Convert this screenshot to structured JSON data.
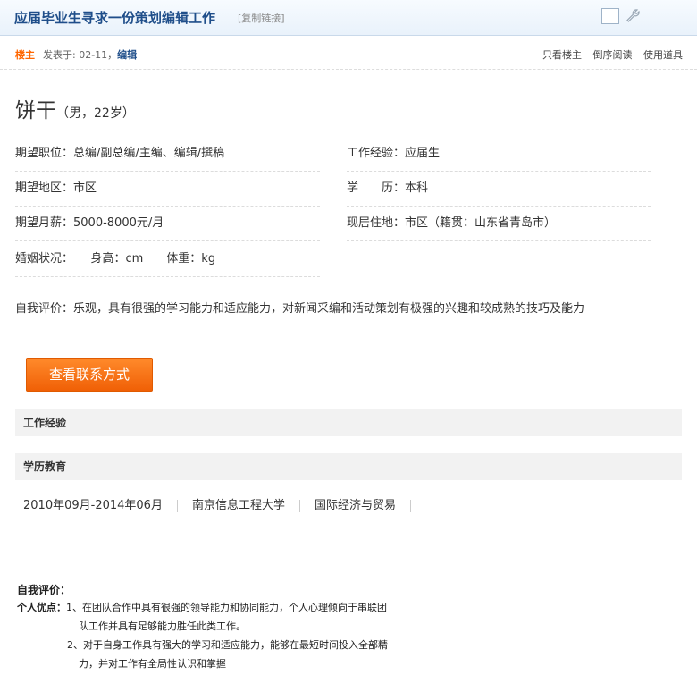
{
  "header": {
    "title": "应届毕业生寻求一份策划编辑工作",
    "copy_link": "[复制链接]"
  },
  "post": {
    "owner_label": "楼主",
    "posted_prefix": "发表于: 02-11，",
    "edit_label": "编辑",
    "links": [
      "只看楼主",
      "倒序阅读",
      "使用道具"
    ]
  },
  "resume": {
    "name": "饼干",
    "gender_age": "（男，22岁）",
    "fields": {
      "position": "期望职位：总编/副总编/主编、编辑/撰稿",
      "experience": "工作经验：应届生",
      "region": "期望地区：市区",
      "education": "学　　历：本科",
      "salary": "期望月薪：5000-8000元/月",
      "residence": "现居住地：市区（籍贯：山东省青岛市）",
      "marital": "婚姻状况：　　身高：cm　　体重：kg"
    },
    "self_evaluation": "自我评价：乐观，具有很强的学习能力和适应能力，对新闻采编和活动策划有极强的兴趣和较成熟的技巧及能力",
    "contact_button": "查看联系方式"
  },
  "sections": {
    "work": "工作经验",
    "education": "学历教育"
  },
  "education_entry": {
    "period": "2010年09月-2014年06月",
    "school": "南京信息工程大学",
    "major": "国际经济与贸易"
  },
  "self_eval_detail": {
    "title": "自我评价：",
    "label": "个人优点：",
    "lines": [
      "1、在团队合作中具有很强的领导能力和协同能力，个人心理倾向于串联团",
      "队工作并具有足够能力胜任此类工作。",
      "2、对于自身工作具有强大的学习和适应能力，能够在最短时间投入全部精",
      "力，并对工作有全局性认识和掌握"
    ]
  }
}
